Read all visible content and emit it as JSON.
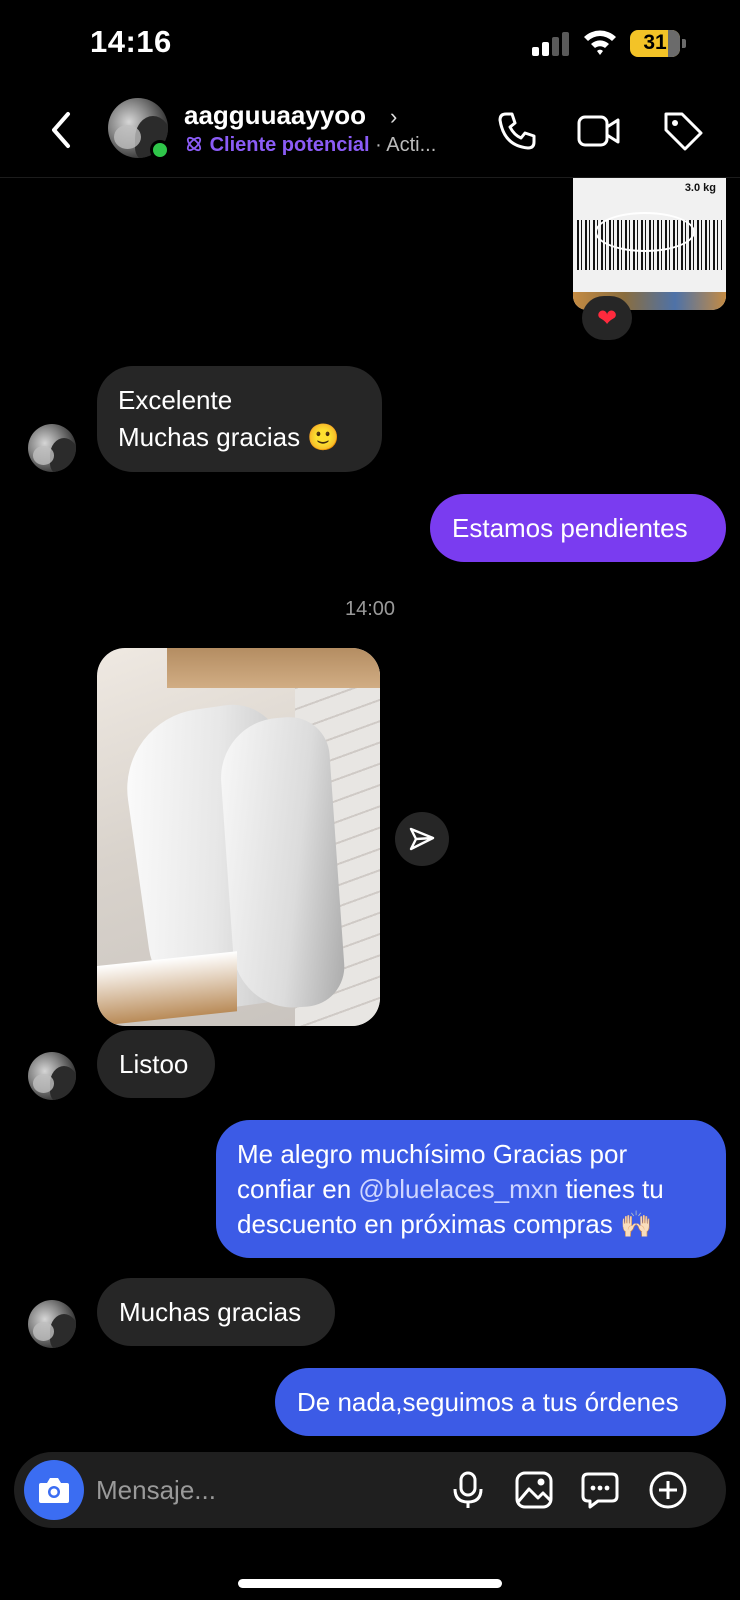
{
  "status_bar": {
    "time": "14:16",
    "battery": "31"
  },
  "header": {
    "username": "aagguuaayyoo",
    "label": "Cliente potencial",
    "separator": "·",
    "activity": "Acti..."
  },
  "attachment": {
    "weight": "3.0 kg",
    "reaction": "❤"
  },
  "messages": [
    {
      "direction": "in",
      "lines": [
        "Excelente",
        "Muchas gracias 🙂"
      ]
    },
    {
      "direction": "out",
      "text": "Estamos pendientes"
    },
    {
      "direction": "in",
      "text": "Listoo"
    },
    {
      "direction": "out",
      "lines": [
        "Me alegro muchísimo Gracias por",
        "confiar en ",
        "@bluelaces_mxn",
        " tienes tu",
        "descuento en próximas compras 🙌🏻"
      ]
    },
    {
      "direction": "in",
      "text": "Muchas gracias"
    },
    {
      "direction": "out",
      "text": "De nada,seguimos a tus órdenes"
    }
  ],
  "timestamp": "14:00",
  "composer": {
    "placeholder": "Mensaje..."
  },
  "colors": {
    "purple": "#7a3cf0",
    "blue": "#3c5be6",
    "incoming": "#262626",
    "online": "#2fc64a",
    "camera": "#3b6df2"
  }
}
